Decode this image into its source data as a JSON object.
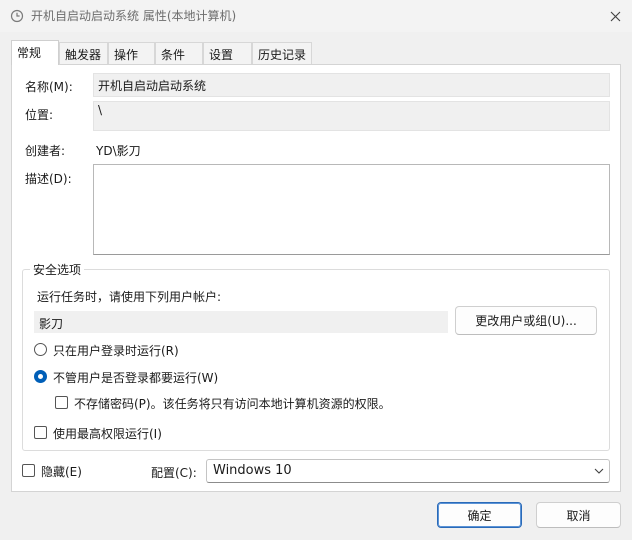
{
  "window": {
    "title": "开机自启动启动系统 属性(本地计算机)",
    "close_glyph": "✕"
  },
  "tabs": [
    {
      "label": "常规",
      "active": true
    },
    {
      "label": "触发器"
    },
    {
      "label": "操作"
    },
    {
      "label": "条件"
    },
    {
      "label": "设置"
    },
    {
      "label": "历史记录"
    }
  ],
  "general": {
    "name_label": "名称(M):",
    "name_value": "开机自启动启动系统",
    "location_label": "位置:",
    "location_value": "\\",
    "author_label": "创建者:",
    "author_value": "YD\\影刀",
    "description_label": "描述(D):",
    "description_value": ""
  },
  "security": {
    "group_title": "安全选项",
    "run_as_label": "运行任务时，请使用下列用户帐户:",
    "user_account": "影刀",
    "change_user_button": "更改用户或组(U)...",
    "radio_logged_on_only": "只在用户登录时运行(R)",
    "radio_whether_logged_on": "不管用户是否登录都要运行(W)",
    "selected_radio": "radio_whether_logged_on",
    "check_do_not_store_password": "不存储密码(P)。该任务将只有访问本地计算机资源的权限。",
    "check_highest_privileges": "使用最高权限运行(I)"
  },
  "bottom": {
    "hidden_label": "隐藏(E)",
    "configure_label": "配置(C):",
    "configure_value": "Windows 10"
  },
  "buttons": {
    "ok": "确定",
    "cancel": "取消"
  },
  "colors": {
    "accent": "#005fb8",
    "window_bg": "#f0f0f0",
    "panel_bg": "#ffffff"
  }
}
